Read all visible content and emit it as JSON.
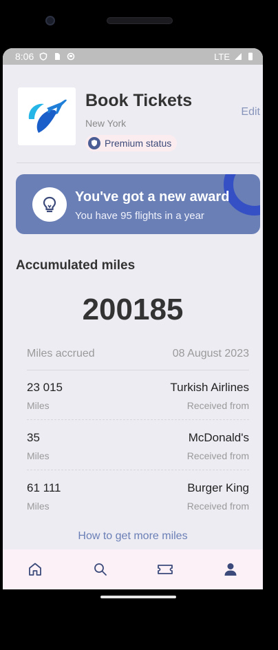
{
  "status_bar": {
    "time": "8:06",
    "network": "LTE",
    "icons": [
      "shield-status-icon",
      "sim-icon",
      "sync-icon",
      "signal-icon",
      "battery-icon"
    ]
  },
  "profile": {
    "title": "Book Tickets",
    "city": "New York",
    "badge": "Premium status",
    "edit": "Edit",
    "logo_icon": "airplane-logo-icon"
  },
  "award": {
    "title": "You've got a new award",
    "subtitle": "You have 95 flights in a year",
    "icon": "lightbulb-icon"
  },
  "miles": {
    "section_title": "Accumulated miles",
    "total": "200185",
    "header_label": "Miles accrued",
    "header_date": "08 August 2023",
    "entries": [
      {
        "amount": "23 015",
        "unit": "Miles",
        "company": "Turkish Airlines",
        "note": "Received from"
      },
      {
        "amount": "35",
        "unit": "Miles",
        "company": "McDonald's",
        "note": "Received from"
      },
      {
        "amount": "61 111",
        "unit": "Miles",
        "company": "Burger King",
        "note": "Received from"
      }
    ],
    "link": "How to get more miles"
  },
  "navigation": {
    "items": [
      "home-icon",
      "search-icon",
      "ticket-icon",
      "profile-icon"
    ],
    "active_color": "#3b4a7a"
  },
  "colors": {
    "accent": "#6a7fb6",
    "award_ring": "#3550c4",
    "badge_bg": "#fbecef",
    "background": "#edecf3"
  }
}
